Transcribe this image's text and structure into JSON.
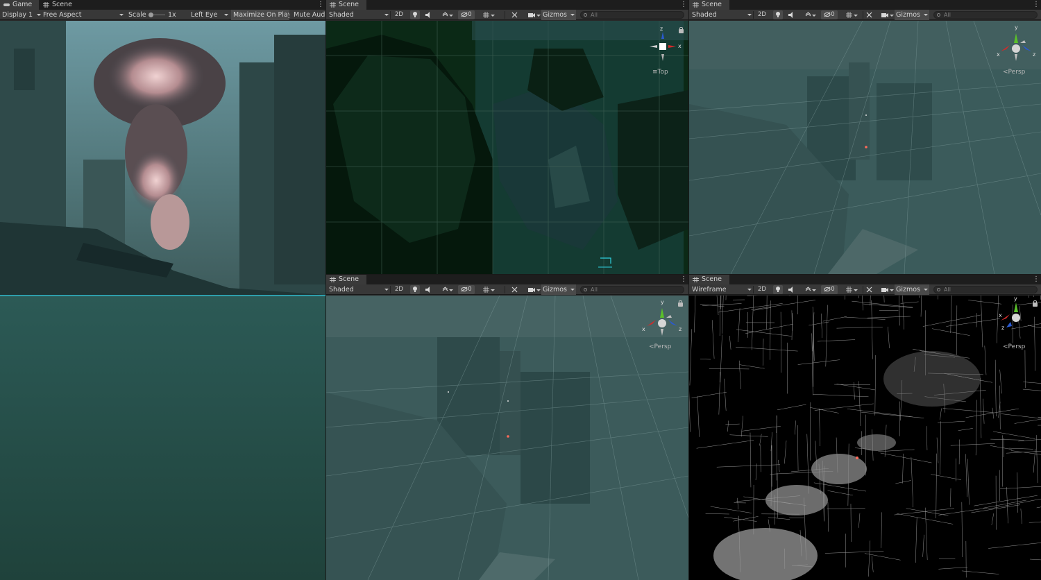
{
  "game_panel": {
    "tabs": [
      {
        "label": "Game"
      },
      {
        "label": "Scene"
      }
    ],
    "toolbar": {
      "display": "Display 1",
      "aspect": "Free Aspect",
      "scale_label": "Scale",
      "scale_value": "1x",
      "eye": "Left Eye",
      "maximize": "Maximize On Play",
      "mute": "Mute Audio"
    }
  },
  "scene_top": {
    "tab": "Scene",
    "draw_mode": "Shaded",
    "mode_2d": "2D",
    "hidden_count": "0",
    "gizmos": "Gizmos",
    "search_placeholder": "All",
    "projection": "Top",
    "axes": {
      "z": "z",
      "x": "x"
    }
  },
  "scene_persp_top_right": {
    "tab": "Scene",
    "draw_mode": "Shaded",
    "mode_2d": "2D",
    "hidden_count": "0",
    "gizmos": "Gizmos",
    "search_placeholder": "All",
    "projection": "Persp",
    "axes": {
      "y": "y",
      "x": "x",
      "z": "z"
    }
  },
  "scene_persp_bottom_mid": {
    "tab": "Scene",
    "draw_mode": "Shaded",
    "mode_2d": "2D",
    "hidden_count": "0",
    "gizmos": "Gizmos",
    "search_placeholder": "All",
    "projection": "Persp",
    "axes": {
      "y": "y",
      "x": "x",
      "z": "z"
    }
  },
  "scene_wireframe": {
    "tab": "Scene",
    "draw_mode": "Wireframe",
    "mode_2d": "2D",
    "hidden_count": "0",
    "gizmos": "Gizmos",
    "search_placeholder": "All",
    "projection": "Persp",
    "axes": {
      "y": "y",
      "x": "x",
      "z": "z"
    }
  },
  "colors": {
    "fog": "#3d5c5c",
    "ground": "#23453e",
    "top_view": "#0c2a17",
    "wire_bg": "#000000",
    "axis_x": "#d12a2a",
    "axis_y": "#5ac02a",
    "axis_z": "#2a5ad1"
  }
}
